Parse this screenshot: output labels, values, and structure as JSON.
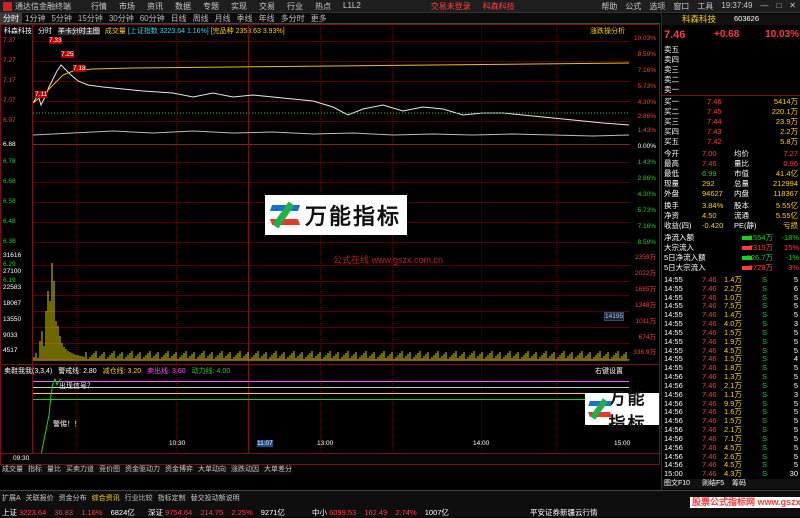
{
  "titlebar": {
    "app": "通达信金融终端",
    "menu": [
      "行情",
      "市场",
      "资讯",
      "数据",
      "专题",
      "实现",
      "交易",
      "行业",
      "热点",
      "L1L2"
    ],
    "promo1": "交易未登录",
    "promo2": "科森科技",
    "right": [
      "帮助",
      "公式",
      "选项",
      "窗口",
      "工具"
    ],
    "clock": "19:37:49"
  },
  "tabs": [
    "分时",
    "1分钟",
    "5分钟",
    "15分钟",
    "30分钟",
    "60分钟",
    "日线",
    "周线",
    "月线",
    "季线",
    "年线",
    "多分时",
    "更多"
  ],
  "chart": {
    "legend": {
      "name": "科森科技",
      "mode": "分时",
      "title": "羊卡分时主图",
      "vol": "成交量",
      "idx": "[上证指数 3223.64 1.16%]",
      "idx2": "[完品种 2353.63 3.93%]",
      "right": "涨跌操分析"
    },
    "price_labels": [
      "7.37",
      "7.27",
      "7.17",
      "7.07",
      "6.97",
      "6.88",
      "6.78",
      "6.68",
      "6.58",
      "6.48",
      "6.38",
      "6.29",
      "6.19"
    ],
    "pct_labels": [
      "10.03%",
      "8.59%",
      "7.16%",
      "5.73%",
      "4.30%",
      "2.86%",
      "1.43%",
      "0.00%",
      "1.43%",
      "2.86%",
      "4.30%",
      "5.73%",
      "7.16%",
      "8.59%"
    ],
    "vol_labels": [
      "31616",
      "27100",
      "22583",
      "18067",
      "13550",
      "9033",
      "4517"
    ],
    "vol_right": [
      "2359万",
      "2022万",
      "1685万",
      "1348万",
      "1011万",
      "674万",
      "336.9万"
    ],
    "vol_cursor": "14195",
    "indicator": {
      "name": "卖鞋我我(3,3,4)",
      "l1": "警戒线: 2.80",
      "l2": "减仓线: 3.20",
      "l3": "卖出线: 3.60",
      "l4": "动力线: 4.00",
      "right": "右键设置",
      "note1": "出现信号？",
      "note2": "警惕！！"
    },
    "time_labels": [
      "09:30",
      "10:30",
      "11:07",
      "13:00",
      "14:00",
      "15:00"
    ],
    "watermark": "万能指标",
    "site": "公式在线 www.gszx.com.cn",
    "price_ticks": [
      "7.33",
      "7.25",
      "7.18",
      "7.11"
    ]
  },
  "quote": {
    "name": "科森科技",
    "code": "603626",
    "price": "7.46",
    "change": "+0.68",
    "pct": "10.03%",
    "sells": [
      {
        "l": "卖五",
        "p": "",
        "v": ""
      },
      {
        "l": "卖四",
        "p": "",
        "v": ""
      },
      {
        "l": "卖三",
        "p": "",
        "v": ""
      },
      {
        "l": "卖二",
        "p": "",
        "v": ""
      },
      {
        "l": "卖一",
        "p": "",
        "v": ""
      }
    ],
    "buys": [
      {
        "l": "买一",
        "p": "7.46",
        "v": "5414万"
      },
      {
        "l": "买二",
        "p": "7.45",
        "v": "220.1万"
      },
      {
        "l": "买三",
        "p": "7.44",
        "v": "23.9万"
      },
      {
        "l": "买四",
        "p": "7.43",
        "v": "2.2万"
      },
      {
        "l": "买五",
        "p": "7.42",
        "v": "5.8万"
      }
    ],
    "stats": [
      [
        "今开",
        "7.00",
        "均价",
        "7.27"
      ],
      [
        "最高",
        "7.46",
        "量比",
        "0.96"
      ],
      [
        "最低",
        "6.99",
        "市值",
        "41.4亿"
      ],
      [
        "现量",
        "292",
        "总量",
        "212994"
      ],
      [
        "外盘",
        "94627",
        "内盘",
        "118367"
      ]
    ],
    "stats2": [
      [
        "换手",
        "3.84%",
        "股本",
        "5.55亿"
      ],
      [
        "净资",
        "4.50",
        "流通",
        "5.55亿"
      ],
      [
        "收益(四)",
        "-0.420",
        "PE(静)",
        "亏损"
      ]
    ],
    "flows": [
      {
        "l": "净流入额",
        "v": "-1554万",
        "p": "-18%"
      },
      {
        "l": "大宗流入",
        "v": "2315万",
        "p": "15%"
      },
      {
        "l": "5日净流入额",
        "v": "-526.7万",
        "p": "-1%"
      },
      {
        "l": "5日大宗流入",
        "v": "2728万",
        "p": "3%"
      }
    ],
    "ticks": [
      [
        "14:55",
        "7.46",
        "1.4万",
        "S",
        "5"
      ],
      [
        "14:55",
        "7.46",
        "2.2万",
        "S",
        "6"
      ],
      [
        "14:55",
        "7.46",
        "1.0万",
        "S",
        "5"
      ],
      [
        "14:55",
        "7.46",
        "7.5万",
        "S",
        "5"
      ],
      [
        "14:55",
        "7.46",
        "1.4万",
        "S",
        "5"
      ],
      [
        "14:55",
        "7.46",
        "4.0万",
        "S",
        "3"
      ],
      [
        "14:55",
        "7.46",
        "1.5万",
        "S",
        "5"
      ],
      [
        "14:55",
        "7.46",
        "1.9万",
        "S",
        "5"
      ],
      [
        "14:55",
        "7.46",
        "4.5万",
        "S",
        "5"
      ],
      [
        "14:55",
        "7.46",
        "1.5万",
        "S",
        "4"
      ],
      [
        "14:55",
        "7.46",
        "1.8万",
        "S",
        "5"
      ],
      [
        "14:56",
        "7.46",
        "1.3万",
        "S",
        "5"
      ],
      [
        "14:56",
        "7.46",
        "2.1万",
        "S",
        "5"
      ],
      [
        "14:56",
        "7.46",
        "1.1万",
        "S",
        "3"
      ],
      [
        "14:56",
        "7.46",
        "9.9万",
        "S",
        "5"
      ],
      [
        "14:56",
        "7.46",
        "1.6万",
        "S",
        "5"
      ],
      [
        "14:56",
        "7.46",
        "1.5万",
        "S",
        "5"
      ],
      [
        "14:56",
        "7.46",
        "2.1万",
        "S",
        "5"
      ],
      [
        "14:56",
        "7.46",
        "7.1万",
        "S",
        "5"
      ],
      [
        "14:56",
        "7.46",
        "4.5万",
        "S",
        "5"
      ],
      [
        "14:56",
        "7.46",
        "2.6万",
        "S",
        "5"
      ],
      [
        "14:56",
        "7.46",
        "4.5万",
        "S",
        "5"
      ],
      [
        "15:00",
        "7.46",
        "4.3万",
        "S",
        "30"
      ]
    ],
    "bottom_tab": "图文F10",
    "link": "则结F5",
    "page": "筹码"
  },
  "bottom": {
    "tabs": [
      "扩展A",
      "关联报价",
      "资金分布",
      "综合资讯",
      "行业比较",
      "指标定制",
      "替交投动额说明"
    ],
    "tabs2": [
      "成交量",
      "指标",
      "量比",
      "买卖力道",
      "竞价图",
      "资金驱动力",
      "资金博弈",
      "大单动向",
      "涨跌动因",
      "大单差分"
    ],
    "indices": [
      {
        "n": "上证",
        "v": "3223.64",
        "c": "36.83",
        "p": "1.16%",
        "a": "6824亿"
      },
      {
        "n": "深证",
        "v": "9754.64",
        "c": "214.75",
        "p": "2.25%",
        "a": "9271亿"
      },
      {
        "n": "中小",
        "v": "6099.53",
        "c": "162.49",
        "p": "2.74%",
        "a": "1007亿"
      }
    ],
    "broker": "平安证券新疆云行情",
    "site": "股票公式指标网 www.gszx.com.cn"
  }
}
